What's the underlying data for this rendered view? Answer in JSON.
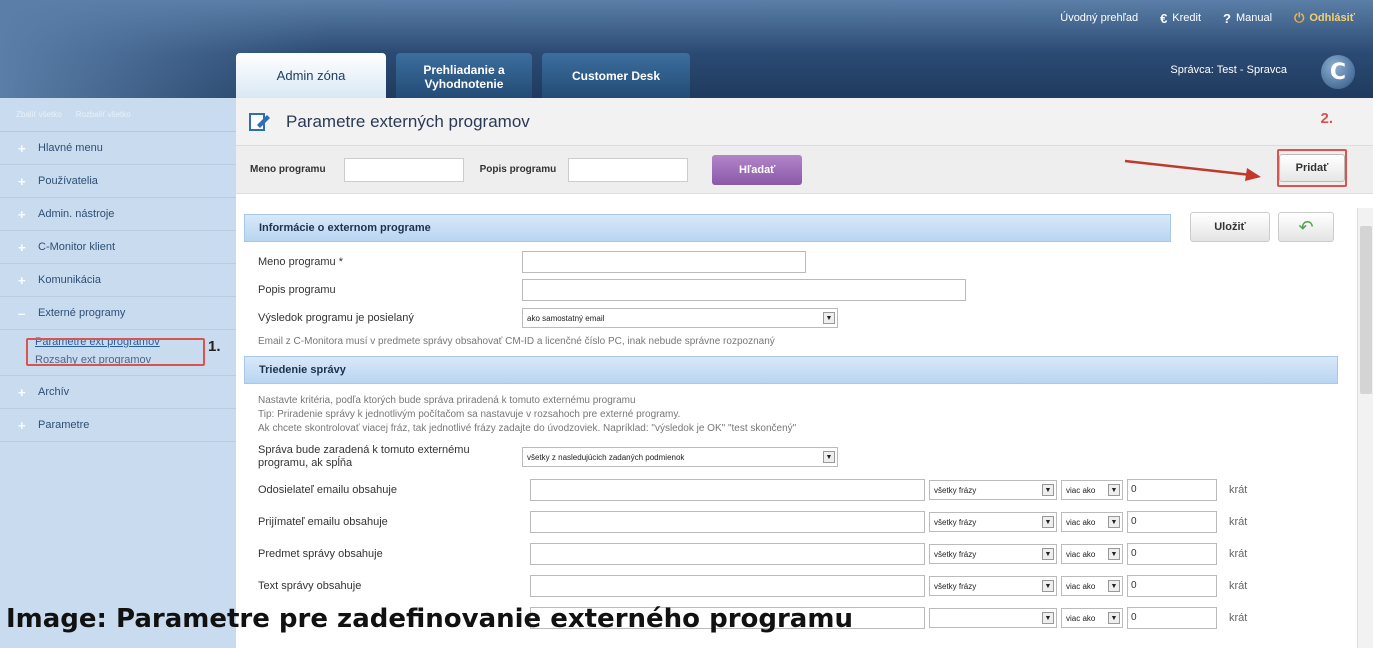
{
  "top_links": {
    "overview": "Úvodný prehľad",
    "credit": "Kredit",
    "manual": "Manual",
    "logout": "Odhlásiť"
  },
  "tabs": [
    {
      "label": "Admin zóna"
    },
    {
      "label": "Prehliadanie a Vyhodnotenie"
    },
    {
      "label": "Customer Desk"
    }
  ],
  "admin_info": "Správca: Test - Spravca",
  "logo_letter": "C",
  "sidebar": {
    "collapse_all": "Zbaliť všetko",
    "expand_all": "Rozbaliť všetko",
    "items": [
      {
        "label": "Hlavné menu"
      },
      {
        "label": "Používatelia"
      },
      {
        "label": "Admin. nástroje"
      },
      {
        "label": "C-Monitor klient"
      },
      {
        "label": "Komunikácia"
      },
      {
        "label": "Externé programy"
      },
      {
        "label": "Archív"
      },
      {
        "label": "Parametre"
      }
    ],
    "sub_items": [
      {
        "label": "Parametre ext programov"
      },
      {
        "label": "Rozsahy ext programov"
      }
    ]
  },
  "callouts": {
    "one": "1.",
    "two": "2."
  },
  "page_title": "Parametre externých programov",
  "filter": {
    "name_label": "Meno programu",
    "desc_label": "Popis programu",
    "search_btn": "Hľadať",
    "add_btn": "Pridať"
  },
  "section1": {
    "title": "Informácie o externom programe",
    "save_btn": "Uložiť",
    "name_label": "Meno programu *",
    "desc_label": "Popis programu",
    "send_label": "Výsledok programu je posielaný",
    "send_value": "ako samostatný email",
    "note": "Email z C-Monitora musí v predmete správy obsahovať CM-ID a licenčné číslo PC, inak nebude správne rozpoznaný"
  },
  "section2": {
    "title": "Triedenie správy",
    "note1": "Nastavte kritéria, podľa ktorých bude správa priradená k tomuto externému programu",
    "note2": "Tip: Priradenie správy k jednotlivým počítačom sa nastavuje v rozsahoch pre externé programy.",
    "note3": "Ak chcete skontrolovať viacej fráz, tak jednotlivé frázy zadajte do úvodzoviek. Napríklad: \"výsledok je OK\" \"test skončený\"",
    "assign_label": "Správa bude zaradená k tomuto externému programu, ak spĺňa",
    "assign_value": "všetky z nasledujúcich zadaných podmienok",
    "criteria": [
      {
        "label": "Odosielateľ emailu obsahuje",
        "phrase": "všetky frázy",
        "cmp": "viac ako",
        "count": "0",
        "unit": "krát"
      },
      {
        "label": "Prijímateľ emailu obsahuje",
        "phrase": "všetky frázy",
        "cmp": "viac ako",
        "count": "0",
        "unit": "krát"
      },
      {
        "label": "Predmet správy obsahuje",
        "phrase": "všetky frázy",
        "cmp": "viac ako",
        "count": "0",
        "unit": "krát"
      },
      {
        "label": "Text správy obsahuje",
        "phrase": "všetky frázy",
        "cmp": "viac ako",
        "count": "0",
        "unit": "krát"
      },
      {
        "label": "",
        "phrase": "",
        "cmp": "viac ako",
        "count": "0",
        "unit": "krát"
      }
    ]
  },
  "caption": "Image: Parametre pre zadefinovanie externého programu"
}
